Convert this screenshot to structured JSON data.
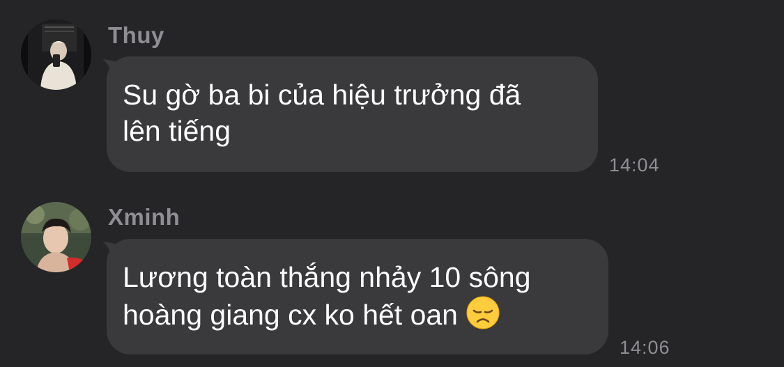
{
  "messages": [
    {
      "sender": "Thuy",
      "lines": [
        "Su gờ ba bi của hiệu trưởng đã",
        "lên tiếng"
      ],
      "time": "14:04"
    },
    {
      "sender": "Xminh",
      "lines": [
        "Lương toàn thắng nhảy 10 sông",
        "hoàng giang cx ko hết oan"
      ],
      "emoji": "disappointed-face",
      "time": "14:06"
    }
  ],
  "colors": {
    "background": "#252527",
    "bubble": "#3a3a3c",
    "text": "#ffffff",
    "meta": "#8e8e93"
  }
}
